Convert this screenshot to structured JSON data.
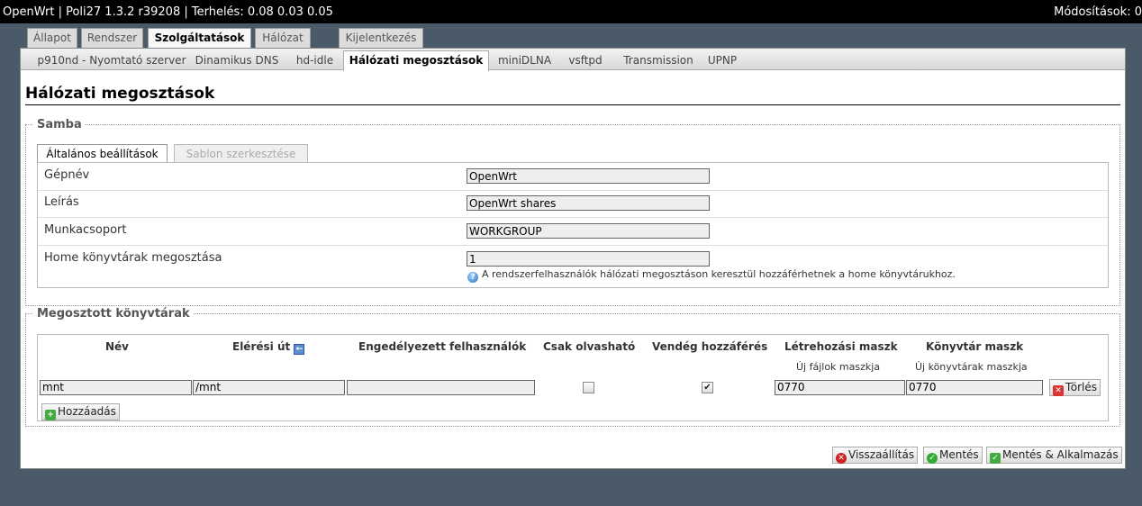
{
  "topbar": {
    "title": "OpenWrt | Poli27 1.3.2 r39208 | Terhelés: 0.08 0.03 0.05",
    "changes": "Módosítások: 0"
  },
  "main_tabs": [
    "Állapot",
    "Rendszer",
    "Szolgáltatások",
    "Hálózat",
    "Kijelentkezés"
  ],
  "sub_tabs": [
    "p910nd - Nyomtató szerver",
    "Dinamikus DNS",
    "hd-idle",
    "Hálózati megosztások",
    "miniDLNA",
    "vsftpd",
    "Transmission",
    "UPNP"
  ],
  "page_title": "Hálózati megosztások",
  "samba": {
    "legend": "Samba",
    "tabs": [
      "Általános beállítások",
      "Sablon szerkesztése"
    ],
    "fields": [
      {
        "label": "Gépnév",
        "value": "OpenWrt"
      },
      {
        "label": "Leírás",
        "value": "OpenWrt shares"
      },
      {
        "label": "Munkacsoport",
        "value": "WORKGROUP"
      },
      {
        "label": "Home könyvtárak megosztása",
        "value": "1"
      }
    ],
    "hint": "A rendszerfelhasználók hálózati megosztáson keresztül hozzáférhetnek a home könyvtárukhoz."
  },
  "shares": {
    "legend": "Megosztott könyvtárak",
    "headers": [
      "Név",
      "Elérési út",
      "Engedélyezett felhasználók",
      "Csak olvasható",
      "Vendég hozzáférés",
      "Létrehozási maszk",
      "Könyvtár maszk"
    ],
    "subheaders": {
      "create_mask": "Új fájlok maszkja",
      "dir_mask": "Új könyvtárak maszkja"
    },
    "rows": [
      {
        "name": "mnt",
        "path": "/mnt",
        "users": "",
        "read_only": false,
        "guest": true,
        "create_mask": "0770",
        "dir_mask": "0770"
      }
    ],
    "delete_label": "Törlés",
    "add_label": "Hozzáadás"
  },
  "footer": {
    "reset": "Visszaállítás",
    "save": "Mentés",
    "save_apply": "Mentés & Alkalmazás"
  }
}
